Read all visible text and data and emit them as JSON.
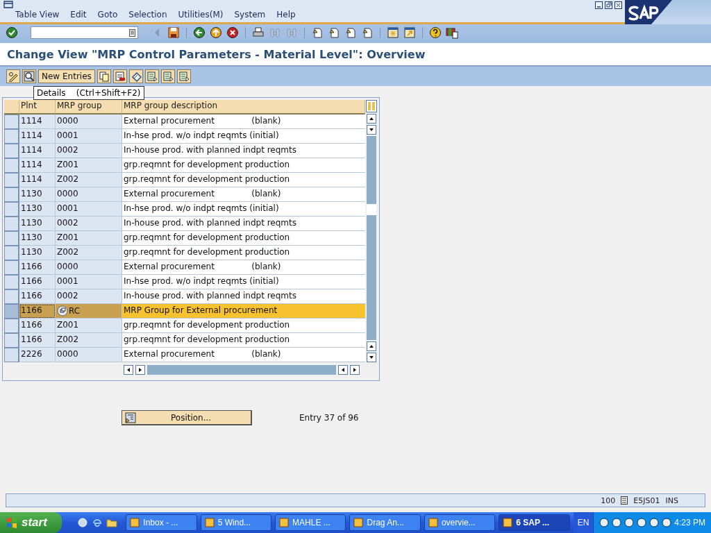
{
  "menu": [
    "Table View",
    "Edit",
    "Goto",
    "Selection",
    "Utilities(M)",
    "System",
    "Help"
  ],
  "title": "Change View \"MRP Control Parameters - Material Level\": Overview",
  "app_toolbar": {
    "new_entries": "New Entries"
  },
  "tooltip": "Details    (Ctrl+Shift+F2)",
  "table": {
    "columns": [
      "Plnt",
      "MRP group",
      "MRP group description"
    ],
    "rows": [
      {
        "cells": [
          "1114",
          "0000",
          "External procurement              (blank)"
        ],
        "selected": false
      },
      {
        "cells": [
          "1114",
          "0001",
          "In-hse prod. w/o indpt reqmts (initial)"
        ],
        "selected": false
      },
      {
        "cells": [
          "1114",
          "0002",
          "In-house prod. with planned indpt reqmts"
        ],
        "selected": false
      },
      {
        "cells": [
          "1114",
          "Z001",
          "grp.reqmnt for development production"
        ],
        "selected": false
      },
      {
        "cells": [
          "1114",
          "Z002",
          "grp.reqmnt for development production"
        ],
        "selected": false
      },
      {
        "cells": [
          "1130",
          "0000",
          "External procurement              (blank)"
        ],
        "selected": false
      },
      {
        "cells": [
          "1130",
          "0001",
          "In-hse prod. w/o indpt reqmts (initial)"
        ],
        "selected": false
      },
      {
        "cells": [
          "1130",
          "0002",
          "In-house prod. with planned indpt reqmts"
        ],
        "selected": false
      },
      {
        "cells": [
          "1130",
          "Z001",
          "grp.reqmnt for development production"
        ],
        "selected": false
      },
      {
        "cells": [
          "1130",
          "Z002",
          "grp.reqmnt for development production"
        ],
        "selected": false
      },
      {
        "cells": [
          "1166",
          "0000",
          "External procurement              (blank)"
        ],
        "selected": false
      },
      {
        "cells": [
          "1166",
          "0001",
          "In-hse prod. w/o indpt reqmts (initial)"
        ],
        "selected": false
      },
      {
        "cells": [
          "1166",
          "0002",
          "In-house prod. with planned indpt reqmts"
        ],
        "selected": false
      },
      {
        "cells": [
          "1166",
          "RC",
          "MRP Group for External procurement"
        ],
        "selected": true
      },
      {
        "cells": [
          "1166",
          "Z001",
          "grp.reqmnt for development production"
        ],
        "selected": false
      },
      {
        "cells": [
          "1166",
          "Z002",
          "grp.reqmnt for development production"
        ],
        "selected": false
      },
      {
        "cells": [
          "2226",
          "0000",
          "External procurement              (blank)"
        ],
        "selected": false
      }
    ]
  },
  "position_button": "Position...",
  "entry_info": "Entry 37 of 96",
  "status_bar": [
    "100",
    "E5JS01",
    "INS"
  ],
  "taskbar": {
    "start": "start",
    "tasks": [
      {
        "label": "Inbox - ...",
        "selected": false
      },
      {
        "label": "5 Wind...",
        "selected": false
      },
      {
        "label": "MAHLE ...",
        "selected": false
      },
      {
        "label": "Drag An...",
        "selected": false
      },
      {
        "label": "overvie...",
        "selected": false
      },
      {
        "label": "6 SAP ...",
        "selected": true
      }
    ],
    "language": "EN",
    "clock": "4:23 PM"
  }
}
